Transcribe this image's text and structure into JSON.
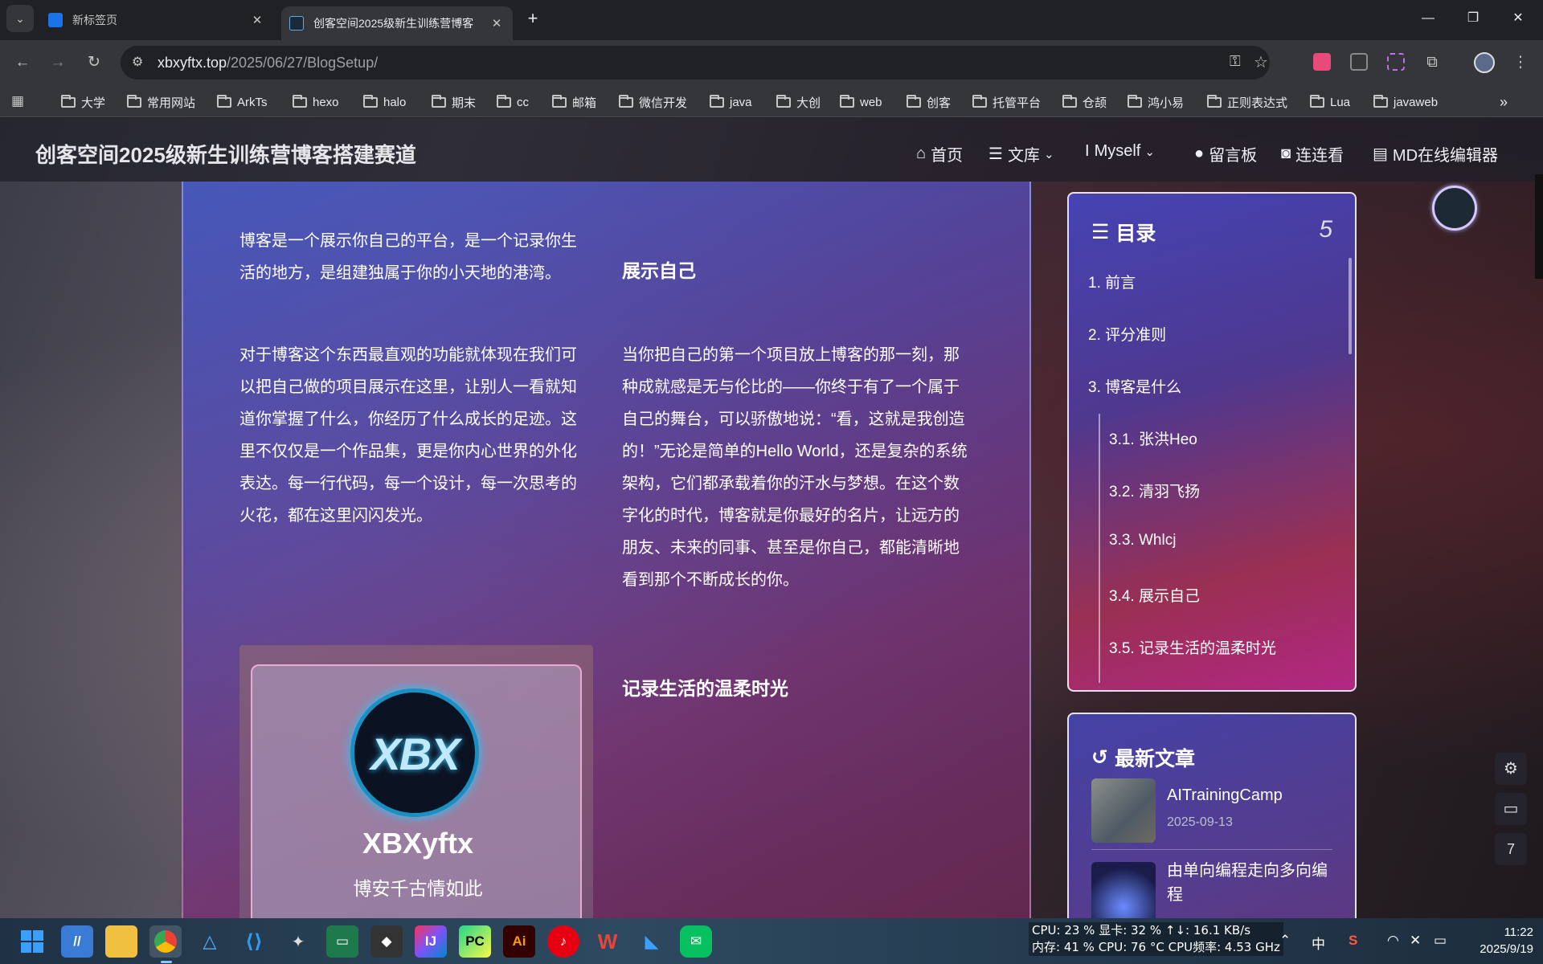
{
  "browser": {
    "tabs": [
      {
        "title": "新标签页",
        "active": false
      },
      {
        "title": "创客空间2025级新生训练营博客",
        "active": true
      }
    ],
    "new_tab": "+",
    "window_controls": [
      "—",
      "❐",
      "✕"
    ],
    "url_host": "xbxyftx.top",
    "url_path": "/2025/06/27/BlogSetup/",
    "bookmarks": [
      "大学",
      "常用网站",
      "ArkTs",
      "hexo",
      "halo",
      "期末",
      "cc",
      "邮箱",
      "微信开发",
      "java",
      "大创",
      "web",
      "创客",
      "托管平台",
      "仓颉",
      "鸿小易",
      "正则表达式",
      "Lua",
      "javaweb"
    ],
    "more": "»"
  },
  "site": {
    "title": "创客空间2025级新生训练营博客搭建赛道",
    "nav": {
      "home": "首页",
      "library": "文库",
      "myself": "Myself",
      "guestbook": "留言板",
      "links": "连连看",
      "md_editor": "MD在线编辑器"
    }
  },
  "article": {
    "intro": "博客是一个展示你自己的平台，是一个记录你生活的地方，是组建独属于你的小天地的港湾。",
    "p1": "对于博客这个东西最直观的功能就体现在我们可以把自己做的项目展示在这里，让别人一看就知道你掌握了什么，你经历了什么成长的足迹。这里不仅仅是一个作品集，更是你内心世界的外化表达。每一行代码，每一个设计，每一次思考的火花，都在这里闪闪发光。",
    "h_show": "展示自己",
    "p2": "当你把自己的第一个项目放上博客的那一刻，那种成就感是无与伦比的——你终于有了一个属于自己的舞台，可以骄傲地说：“看，这就是我创造的！”无论是简单的Hello World，还是复杂的系统架构，它们都承载着你的汗水与梦想。在这个数字化的时代，博客就是你最好的名片，让远方的朋友、未来的同事、甚至是你自己，都能清晰地看到那个不断成长的你。",
    "h_record": "记录生活的温柔时光",
    "profile": {
      "logo_text": "XBX",
      "name": "XBXyftx",
      "subtitle": "博安千古情如此"
    }
  },
  "toc": {
    "title": "目录",
    "count": "5",
    "items": [
      "1. 前言",
      "2. 评分准则",
      "3. 博客是什么",
      "3.1. 张洪Heo",
      "3.2. 清羽飞扬",
      "3.3. Whlcj",
      "3.4. 展示自己",
      "3.5. 记录生活的温柔时光"
    ]
  },
  "recent": {
    "title": "最新文章",
    "posts": [
      {
        "title": "AITrainingCamp",
        "date": "2025-09-13"
      },
      {
        "title": "由单向编程走向多向编程",
        "date": ""
      }
    ]
  },
  "floating": {
    "badge": "7"
  },
  "taskbar": {
    "apps": [
      "start",
      "copilot",
      "files",
      "chrome",
      "app-a",
      "vscode",
      "app-b",
      "app-c",
      "app-d",
      "idea",
      "pycharm",
      "illustrator",
      "netease",
      "wps",
      "app-e",
      "wechat"
    ],
    "monitor_line1": "CPU: 23 % 显卡: 32 % ↑↓: 16.1 KB/s",
    "monitor_line2": "内存: 41 % CPU: 76 °C CPU频率: 4.53 GHz",
    "ime": "中",
    "time": "11:22",
    "date": "2025/9/19"
  },
  "colors": {
    "accent": "#4f6bd8",
    "toc_end": "#c02d8c",
    "taskbar": "#243a4e"
  }
}
